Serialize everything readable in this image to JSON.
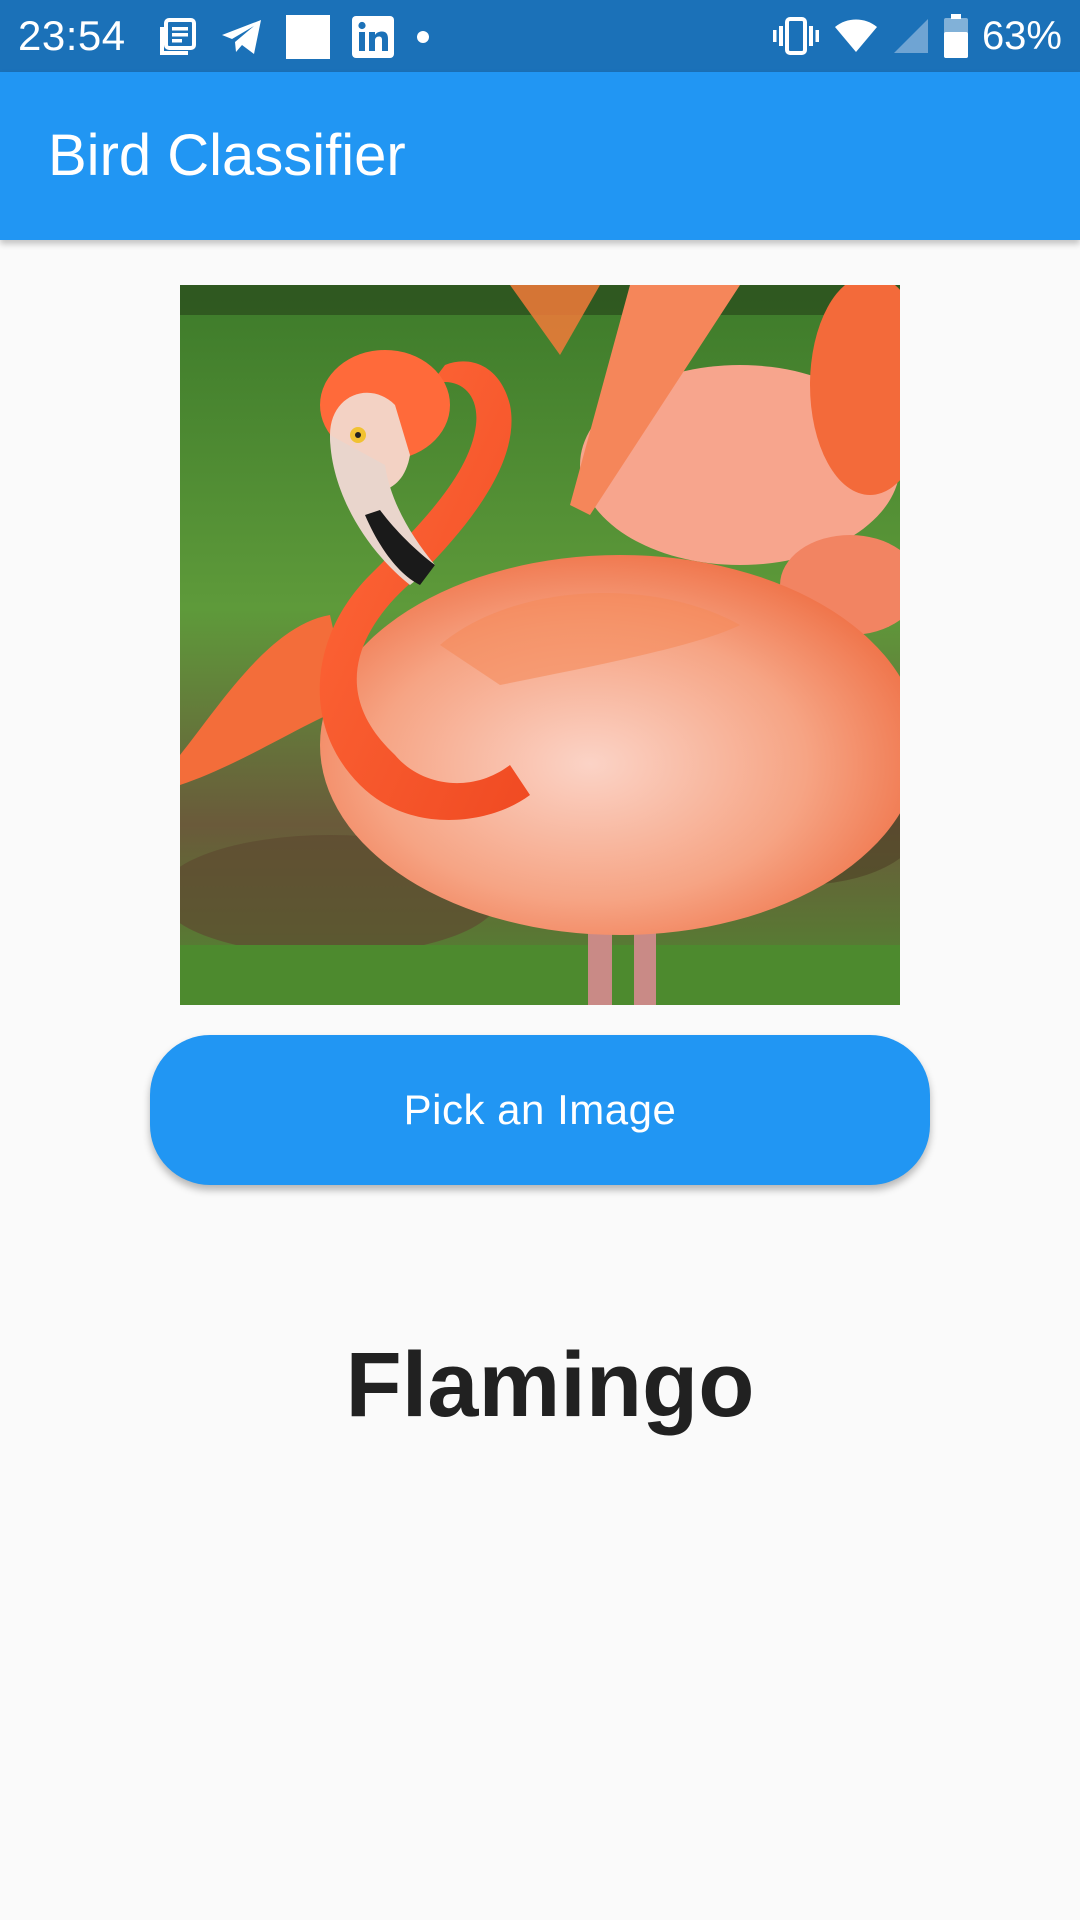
{
  "status_bar": {
    "time": "23:54",
    "battery_percent": "63%",
    "background_color": "#1b71b8",
    "left_icons": [
      "news-icon",
      "telegram-icon",
      "blank-square-icon",
      "linkedin-icon",
      "dot-icon"
    ],
    "right_icons": [
      "vibrate-icon",
      "wifi-icon",
      "cell-signal-icon",
      "battery-icon"
    ]
  },
  "app_bar": {
    "title": "Bird Classifier",
    "background_color": "#2196f3"
  },
  "main": {
    "image": "flamingo-photo",
    "pick_button_label": "Pick an Image",
    "result_label": "Flamingo"
  }
}
